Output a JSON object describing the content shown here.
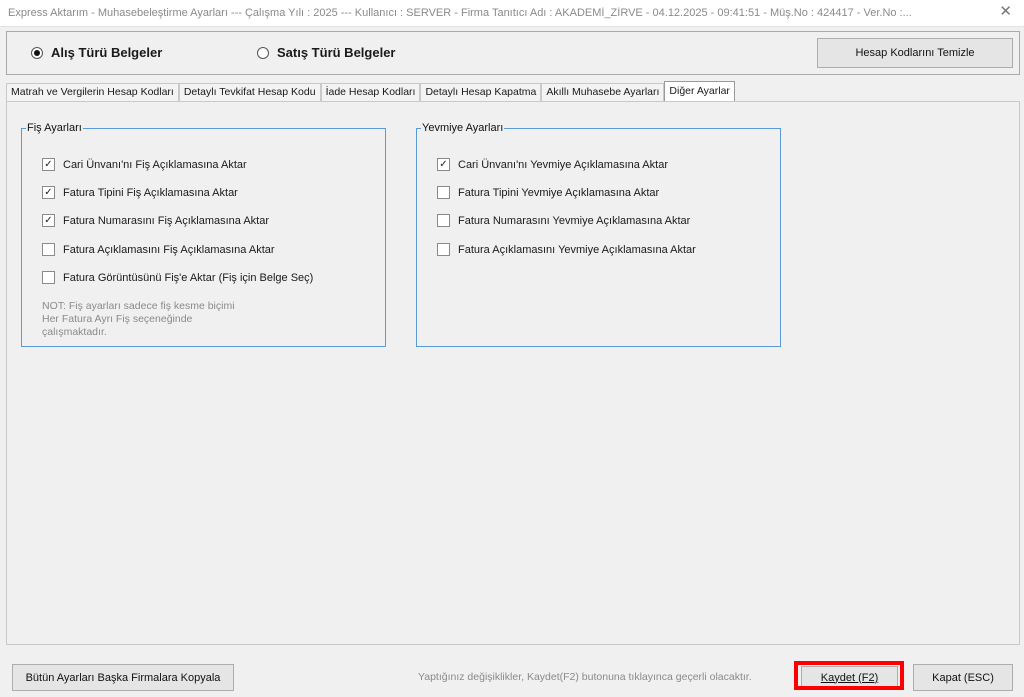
{
  "window": {
    "title": "Express Aktarım - Muhasebeleştirme Ayarları  ---  Çalışma Yılı : 2025  ---  Kullanıcı : SERVER - Firma Tanıtıcı Adı : AKADEMİ_ZİRVE - 04.12.2025 - 09:41:51 - Müş.No : 424417 - Ver.No :...",
    "close_glyph": "✕"
  },
  "doc_type": {
    "options": [
      {
        "label": "Alış Türü Belgeler",
        "selected": true
      },
      {
        "label": "Satış Türü Belgeler",
        "selected": false
      }
    ],
    "clear_button": "Hesap Kodlarını Temizle"
  },
  "tabs": [
    {
      "label": "Matrah ve Vergilerin Hesap Kodları",
      "active": false
    },
    {
      "label": "Detaylı Tevkifat Hesap Kodu",
      "active": false
    },
    {
      "label": "İade Hesap Kodları",
      "active": false
    },
    {
      "label": "Detaylı Hesap Kapatma",
      "active": false
    },
    {
      "label": "Akıllı Muhasebe Ayarları",
      "active": false
    },
    {
      "label": "Diğer Ayarlar",
      "active": true
    }
  ],
  "fis_settings": {
    "legend": "Fiş Ayarları",
    "items": [
      {
        "label": "Cari Ünvanı'nı Fiş Açıklamasına Aktar",
        "checked": true
      },
      {
        "label": "Fatura Tipini Fiş Açıklamasına Aktar",
        "checked": true
      },
      {
        "label": "Fatura Numarasını Fiş Açıklamasına Aktar",
        "checked": true
      },
      {
        "label": "Fatura Açıklamasını Fiş Açıklamasına Aktar",
        "checked": false
      },
      {
        "label": "Fatura Görüntüsünü Fiş'e Aktar (Fiş için Belge Seç)",
        "checked": false
      }
    ],
    "note_lines": [
      "NOT: Fiş ayarları sadece fiş kesme biçimi",
      "Her Fatura Ayrı Fiş seçeneğinde",
      "çalışmaktadır."
    ]
  },
  "yevmiye_settings": {
    "legend": "Yevmiye Ayarları",
    "items": [
      {
        "label": "Cari Ünvanı'nı Yevmiye Açıklamasına Aktar",
        "checked": true
      },
      {
        "label": "Fatura Tipini Yevmiye Açıklamasına Aktar",
        "checked": false
      },
      {
        "label": "Fatura Numarasını Yevmiye Açıklamasına Aktar",
        "checked": false
      },
      {
        "label": "Fatura Açıklamasını Yevmiye Açıklamasına Aktar",
        "checked": false
      }
    ]
  },
  "footer": {
    "copy_button": "Bütün Ayarları Başka Firmalara Kopyala",
    "info": "Yaptığınız değişiklikler, Kaydet(F2) butonuna tıklayınca geçerli olacaktır.",
    "save_button": "Kaydet (F2)",
    "close_button": "Kapat (ESC)"
  },
  "colors": {
    "group_border": "#5b9bd5",
    "highlight": "#ff0000"
  }
}
